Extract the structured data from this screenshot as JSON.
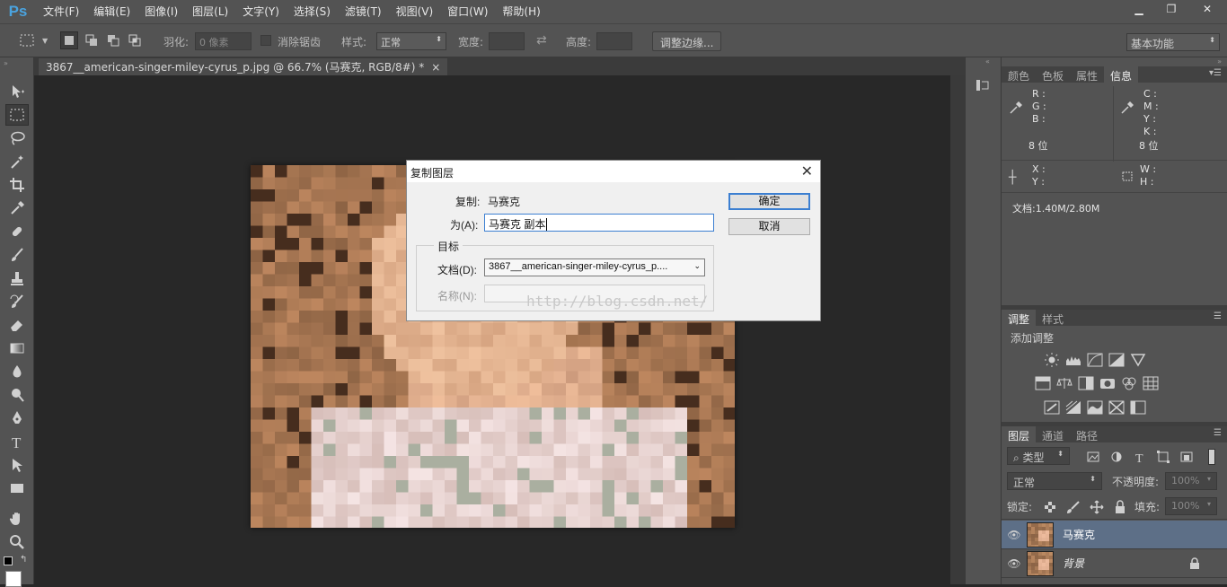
{
  "app": {
    "logo": "Ps"
  },
  "menubar": {
    "items": [
      "文件(F)",
      "编辑(E)",
      "图像(I)",
      "图层(L)",
      "文字(Y)",
      "选择(S)",
      "滤镜(T)",
      "视图(V)",
      "窗口(W)",
      "帮助(H)"
    ]
  },
  "options": {
    "feather_label": "羽化:",
    "feather_value": "0 像素",
    "antialias_label": "消除锯齿",
    "style_label": "样式:",
    "style_value": "正常",
    "width_label": "宽度:",
    "height_label": "高度:",
    "refine_edge": "调整边缘...",
    "workspace": "基本功能"
  },
  "document": {
    "tab_title": "3867__american-singer-miley-cyrus_p.jpg @ 66.7% (马赛克, RGB/8#) *",
    "close": "×"
  },
  "panels": {
    "top_tabs": [
      "颜色",
      "色板",
      "属性",
      "信息"
    ],
    "top_active": 3,
    "info": {
      "r": "R :",
      "g": "G :",
      "b": "B :",
      "c": "C :",
      "m": "M :",
      "y": "Y :",
      "k": "K :",
      "bits_left": "8 位",
      "bits_right": "8 位",
      "x": "X :",
      "yy": "Y :",
      "w": "W :",
      "h": "H :",
      "doc": "文档:1.40M/2.80M"
    },
    "adj_tabs": [
      "调整",
      "样式"
    ],
    "adj_title": "添加调整",
    "layers_tabs": [
      "图层",
      "通道",
      "路径"
    ],
    "filter_kind": "类型",
    "blend_mode": "正常",
    "opacity_label": "不透明度:",
    "opacity_value": "100%",
    "lock_label": "锁定:",
    "fill_label": "填充:",
    "fill_value": "100%",
    "layers": [
      {
        "name": "马赛克",
        "selected": true
      },
      {
        "name": "背景",
        "selected": false
      }
    ]
  },
  "dialog": {
    "title": "复制图层",
    "close": "✕",
    "copy_label": "复制:",
    "copy_value": "马赛克",
    "as_label": "为(A):",
    "as_value": "马赛克 副本",
    "target_group": "目标",
    "doc_label": "文档(D):",
    "doc_value": "3867__american-singer-miley-cyrus_p....",
    "name_label": "名称(N):",
    "ok": "确定",
    "cancel": "取消",
    "watermark": "http://blog.csdn.net/"
  },
  "colors": {
    "ui_dark": "#535353",
    "canvas": "#282828",
    "accent": "#3c7fd1",
    "layer_selected": "#5d6f87"
  }
}
